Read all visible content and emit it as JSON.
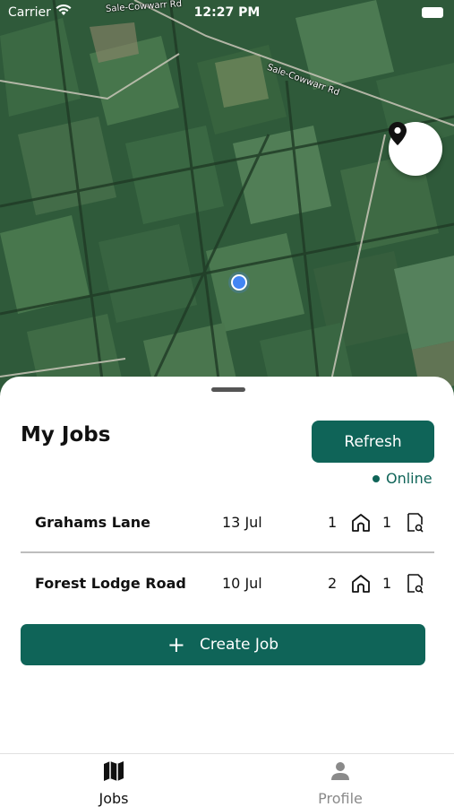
{
  "status_bar": {
    "carrier": "Carrier",
    "time": "12:27 PM"
  },
  "map": {
    "road_labels": [
      "Sale-Cowwarr Rd",
      "Sale-Cowwarr Rd"
    ],
    "locate_icon": "map-pin-icon"
  },
  "sheet": {
    "title": "My Jobs",
    "refresh_label": "Refresh",
    "online_label": "Online",
    "jobs": [
      {
        "name": "Grahams Lane",
        "date": "13 Jul",
        "count_a": "1",
        "count_b": "1"
      },
      {
        "name": "Forest Lodge Road",
        "date": "10 Jul",
        "count_a": "2",
        "count_b": "1"
      }
    ],
    "create_plus": "+",
    "create_label": "Create Job"
  },
  "tabs": [
    {
      "label": "Jobs",
      "icon": "map-icon",
      "active": true
    },
    {
      "label": "Profile",
      "icon": "person-icon",
      "active": false
    }
  ],
  "colors": {
    "accent": "#0f6458",
    "inactive": "#8a8a8a"
  }
}
